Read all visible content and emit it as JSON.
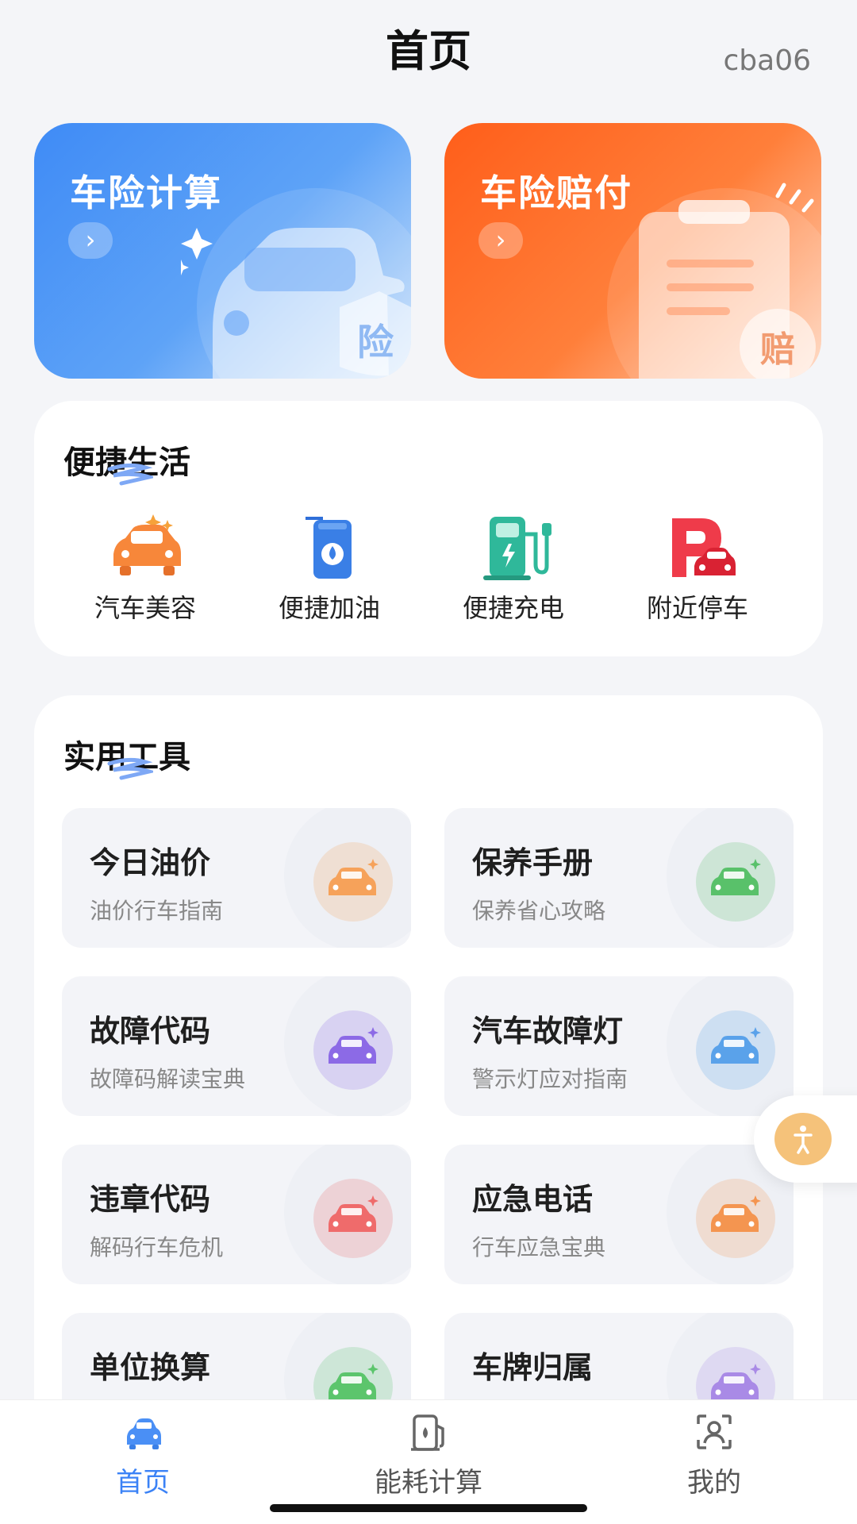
{
  "header": {
    "title": "首页",
    "user": "cba06"
  },
  "banners": [
    {
      "title": "车险计算",
      "arrow": "›",
      "badge": "险"
    },
    {
      "title": "车险赔付",
      "arrow": "›",
      "badge": "赔"
    }
  ],
  "life": {
    "title": "便捷生活",
    "items": [
      {
        "label": "汽车美容",
        "icon": "car-wash-icon"
      },
      {
        "label": "便捷加油",
        "icon": "fuel-can-icon"
      },
      {
        "label": "便捷充电",
        "icon": "charging-station-icon"
      },
      {
        "label": "附近停车",
        "icon": "parking-icon"
      }
    ]
  },
  "tools": {
    "title": "实用工具",
    "items": [
      {
        "title": "今日油价",
        "subtitle": "油价行车指南",
        "color": "#f6a25a"
      },
      {
        "title": "保养手册",
        "subtitle": "保养省心攻略",
        "color": "#59c16a"
      },
      {
        "title": "故障代码",
        "subtitle": "故障码解读宝典",
        "color": "#8c6ae6"
      },
      {
        "title": "汽车故障灯",
        "subtitle": "警示灯应对指南",
        "color": "#5aa2ea"
      },
      {
        "title": "违章代码",
        "subtitle": "解码行车危机",
        "color": "#ef6b6b"
      },
      {
        "title": "应急电话",
        "subtitle": "行车应急宝典",
        "color": "#f49550"
      },
      {
        "title": "单位换算",
        "subtitle": "",
        "color": "#5cc56c"
      },
      {
        "title": "车牌归属",
        "subtitle": "",
        "color": "#a98ae6"
      }
    ]
  },
  "tabbar": {
    "tabs": [
      {
        "label": "首页",
        "active": true
      },
      {
        "label": "能耗计算",
        "active": false
      },
      {
        "label": "我的",
        "active": false
      }
    ]
  },
  "colors": {
    "accent": "#3b82f6",
    "blue_banner": "#3f8bf6",
    "orange_banner": "#ff6a24"
  }
}
